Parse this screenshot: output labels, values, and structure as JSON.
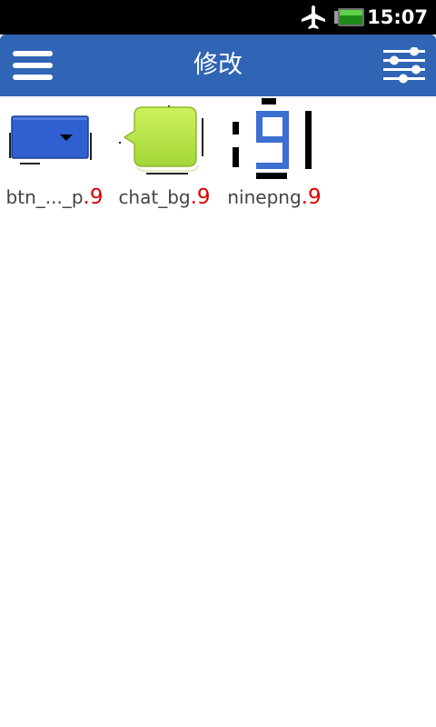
{
  "status_bar": {
    "time": "15:07",
    "icons": [
      "airplane-mode-icon",
      "battery-icon"
    ]
  },
  "header": {
    "title": "修改",
    "menu_icon": "hamburger-menu-icon",
    "settings_icon": "sliders-settings-icon",
    "background": "#3064b4"
  },
  "files": [
    {
      "name": "btn_..._p",
      "ext": ".9",
      "thumbnail": "blue-spinner-button"
    },
    {
      "name": "chat_bg",
      "ext": ".9",
      "thumbnail": "green-speech-bubble"
    },
    {
      "name": "ninepng",
      "ext": ".9",
      "thumbnail": "nine-patch-digit-9"
    }
  ],
  "colors": {
    "extension": "#dd0000",
    "filename": "#444444",
    "bubble": "#bde84a",
    "button": "#2f5fd0"
  }
}
